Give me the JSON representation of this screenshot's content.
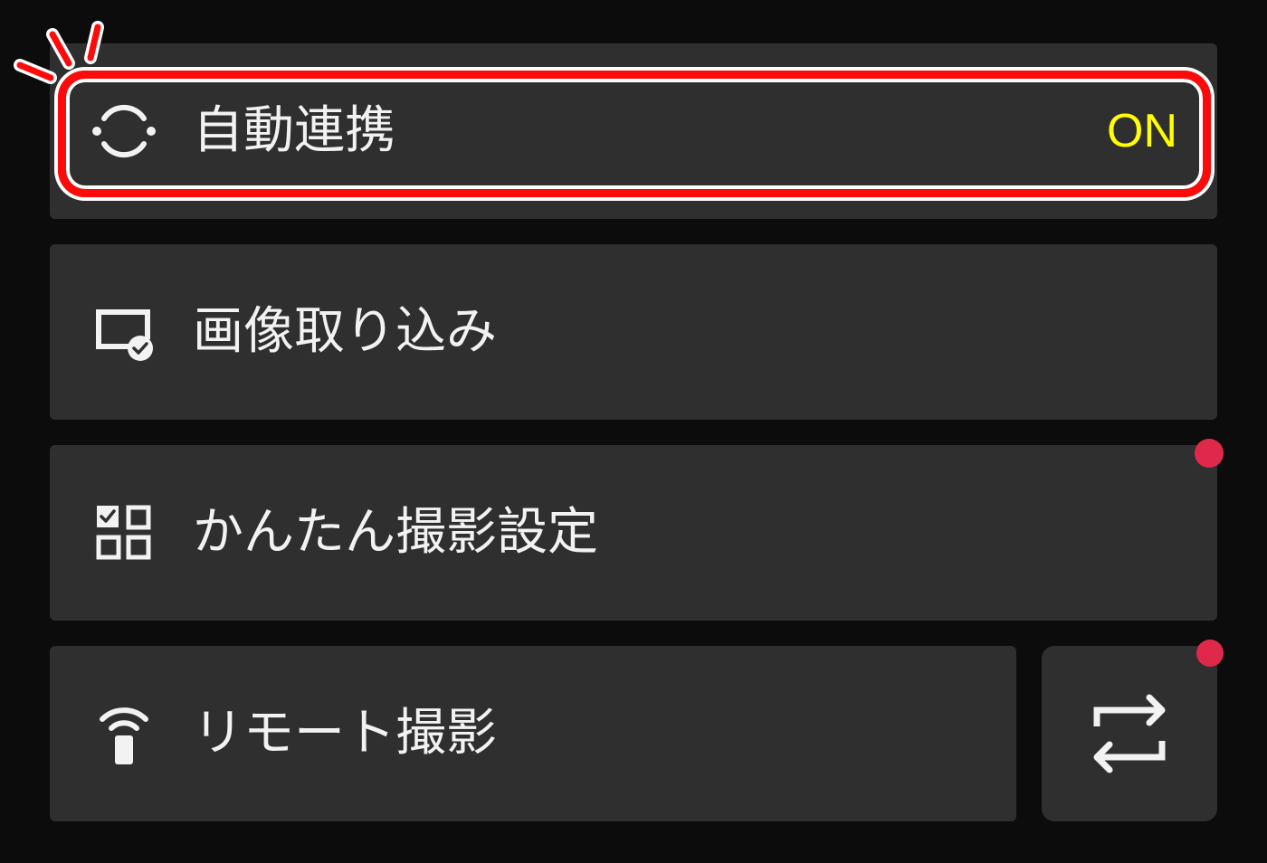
{
  "menu": {
    "items": [
      {
        "id": "auto-link",
        "label": "自動連携",
        "status": "ON",
        "icon": "auto-sync-icon"
      },
      {
        "id": "image-import",
        "label": "画像取り込み",
        "icon": "image-import-icon"
      },
      {
        "id": "easy-shooting",
        "label": "かんたん撮影設定",
        "icon": "grid-checklist-icon",
        "has_notification": true
      },
      {
        "id": "remote-shooting",
        "label": "リモート撮影",
        "icon": "remote-icon"
      }
    ],
    "swap_button": {
      "icon": "swap-arrows-icon",
      "has_notification": true
    }
  },
  "colors": {
    "background": "#0c0c0c",
    "tile": "#2f2f2f",
    "text": "#f2f2f2",
    "status_on": "#ffff00",
    "notification": "#e0294a",
    "highlight": "#ff0a0a"
  }
}
